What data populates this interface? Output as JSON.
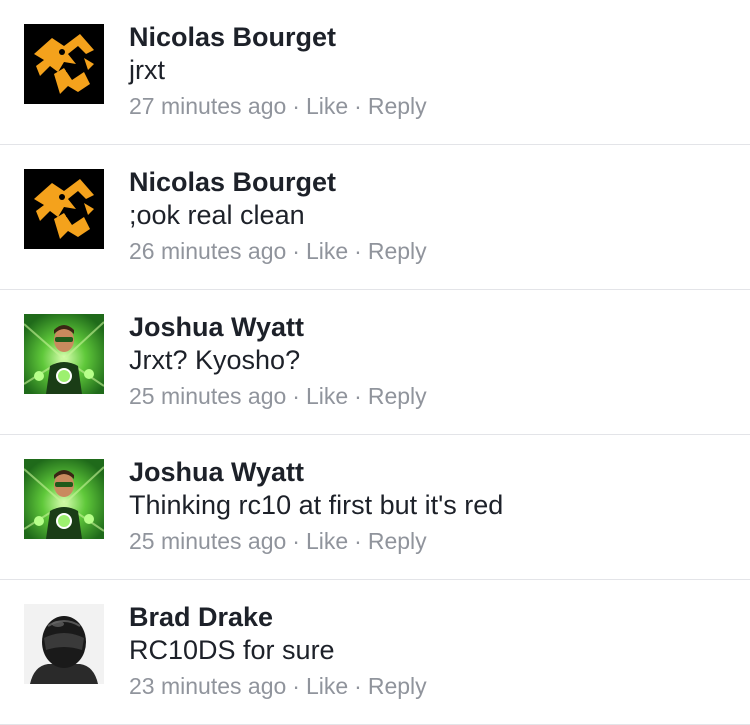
{
  "comments": [
    {
      "avatar": "fox-logo-avatar",
      "author": "Nicolas Bourget",
      "text": "jrxt",
      "time": "27 minutes ago",
      "like": "Like",
      "reply": "Reply"
    },
    {
      "avatar": "fox-logo-avatar",
      "author": "Nicolas Bourget",
      "text": ";ook real clean",
      "time": "26 minutes ago",
      "like": "Like",
      "reply": "Reply"
    },
    {
      "avatar": "green-lantern-avatar",
      "author": "Joshua Wyatt",
      "text": "Jrxt? Kyosho?",
      "time": "25 minutes ago",
      "like": "Like",
      "reply": "Reply"
    },
    {
      "avatar": "green-lantern-avatar",
      "author": "Joshua Wyatt",
      "text": "Thinking rc10 at first but it's red",
      "time": "25 minutes ago",
      "like": "Like",
      "reply": "Reply"
    },
    {
      "avatar": "helmet-avatar",
      "author": "Brad Drake",
      "text": "RC10DS for sure",
      "time": "23 minutes ago",
      "like": "Like",
      "reply": "Reply"
    }
  ],
  "separator": "·",
  "colors": {
    "name": "#1d2129",
    "meta": "#90949c",
    "divider": "#e3e4e8",
    "fox_orange": "#f4a21c",
    "lantern_green": "#3fae2a"
  }
}
